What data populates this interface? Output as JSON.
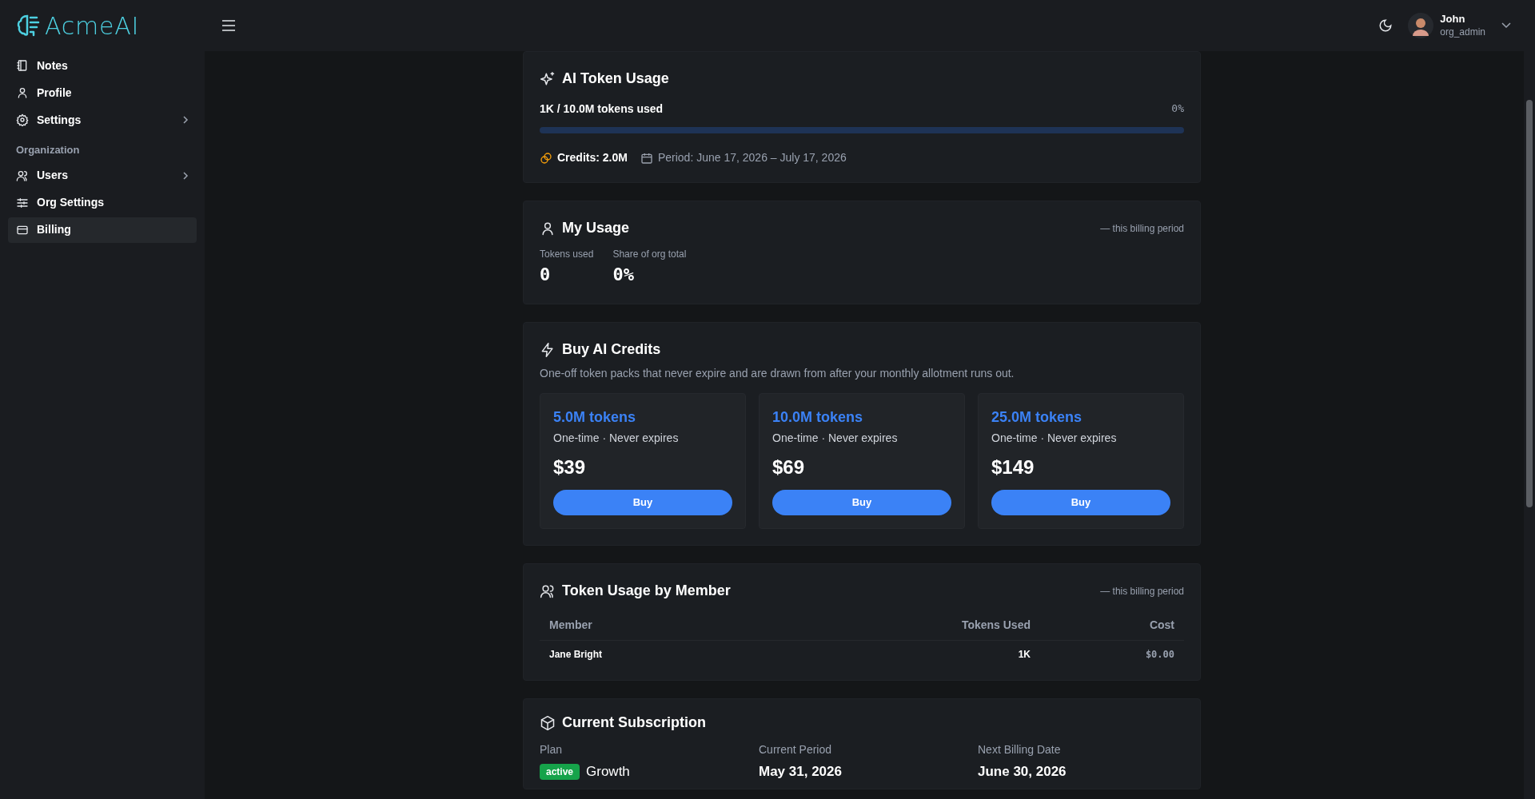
{
  "brand": "AcmeAI",
  "sidebar": {
    "items": [
      {
        "label": "Notes",
        "has_submenu": false,
        "selected": false
      },
      {
        "label": "Profile",
        "has_submenu": false,
        "selected": false
      },
      {
        "label": "Settings",
        "has_submenu": true,
        "selected": false
      }
    ],
    "section": "Organization",
    "org_items": [
      {
        "label": "Users",
        "has_submenu": true,
        "selected": false
      },
      {
        "label": "Org Settings",
        "has_submenu": false,
        "selected": false
      },
      {
        "label": "Billing",
        "has_submenu": false,
        "selected": true
      }
    ]
  },
  "user": {
    "name": "John",
    "role": "org_admin"
  },
  "token_usage": {
    "title": "AI Token Usage",
    "used": "1K / 10.0M tokens used",
    "percent": "0%",
    "level": 0,
    "credits": "Credits: 2.0M",
    "period": "Period: June 17, 2026 – July 17, 2026"
  },
  "my_usage": {
    "title": "My Usage",
    "note": "— this billing period",
    "stats": [
      {
        "label": "Tokens used",
        "value": "0"
      },
      {
        "label": "Share of org total",
        "value": "0%"
      }
    ]
  },
  "buy_credits": {
    "title": "Buy AI Credits",
    "description": "One-off token packs that never expire and are drawn from after your monthly allotment runs out.",
    "packs": [
      {
        "tokens": "5.0M tokens",
        "terms": "One-time · Never expires",
        "price": "$39",
        "button": "Buy"
      },
      {
        "tokens": "10.0M tokens",
        "terms": "One-time · Never expires",
        "price": "$69",
        "button": "Buy"
      },
      {
        "tokens": "25.0M tokens",
        "terms": "One-time · Never expires",
        "price": "$149",
        "button": "Buy"
      }
    ]
  },
  "member_usage": {
    "title": "Token Usage by Member",
    "note": "— this billing period",
    "columns": [
      "Member",
      "Tokens Used",
      "Cost"
    ],
    "rows": [
      [
        "Jane Bright",
        "1K",
        "$0.00"
      ]
    ]
  },
  "subscription": {
    "title": "Current Subscription",
    "fields": [
      {
        "label": "Plan",
        "status": "active",
        "value": "Growth"
      },
      {
        "label": "Current Period",
        "value": "May 31, 2026"
      },
      {
        "label": "Next Billing Date",
        "value": "June 30, 2026"
      }
    ]
  }
}
